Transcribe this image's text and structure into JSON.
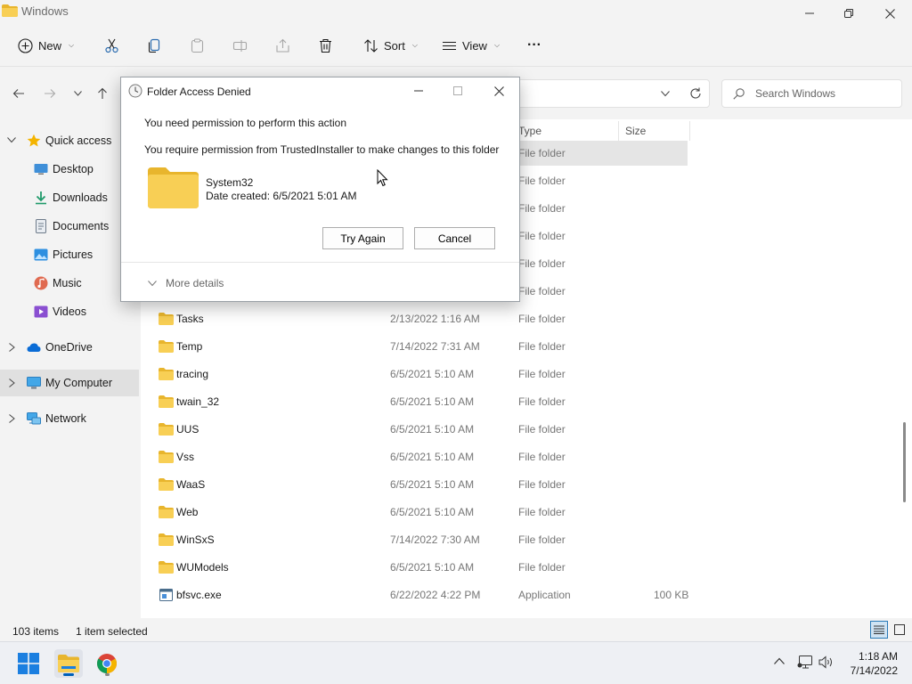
{
  "window": {
    "title": "Windows",
    "minimize_icon": "minimize-icon",
    "maximize_icon": "restore-icon",
    "close_icon": "close-icon"
  },
  "toolbar": {
    "new_label": "New",
    "sort_label": "Sort",
    "view_label": "View",
    "more_label": "···"
  },
  "search": {
    "placeholder": "Search Windows"
  },
  "sidebar": {
    "items": [
      {
        "label": "Quick access",
        "icon": "star-icon"
      },
      {
        "label": "Desktop",
        "icon": "desktop-icon"
      },
      {
        "label": "Downloads",
        "icon": "download-icon"
      },
      {
        "label": "Documents",
        "icon": "documents-icon"
      },
      {
        "label": "Pictures",
        "icon": "pictures-icon"
      },
      {
        "label": "Music",
        "icon": "music-icon"
      },
      {
        "label": "Videos",
        "icon": "videos-icon"
      },
      {
        "label": "OneDrive",
        "icon": "cloud-icon"
      },
      {
        "label": "My Computer",
        "icon": "computer-icon"
      },
      {
        "label": "Network",
        "icon": "network-icon"
      }
    ]
  },
  "columns": {
    "type": "Type",
    "size": "Size"
  },
  "files": [
    {
      "name": "",
      "date": "",
      "type": "File folder",
      "size": ""
    },
    {
      "name": "",
      "date": "",
      "type": "File folder",
      "size": ""
    },
    {
      "name": "",
      "date": "",
      "type": "File folder",
      "size": ""
    },
    {
      "name": "",
      "date": "",
      "type": "File folder",
      "size": ""
    },
    {
      "name": "",
      "date": "",
      "type": "File folder",
      "size": ""
    },
    {
      "name": "",
      "date": "",
      "type": "File folder",
      "size": ""
    },
    {
      "name": "Tasks",
      "date": "2/13/2022 1:16 AM",
      "type": "File folder",
      "size": ""
    },
    {
      "name": "Temp",
      "date": "7/14/2022 7:31 AM",
      "type": "File folder",
      "size": ""
    },
    {
      "name": "tracing",
      "date": "6/5/2021 5:10 AM",
      "type": "File folder",
      "size": ""
    },
    {
      "name": "twain_32",
      "date": "6/5/2021 5:10 AM",
      "type": "File folder",
      "size": ""
    },
    {
      "name": "UUS",
      "date": "6/5/2021 5:10 AM",
      "type": "File folder",
      "size": ""
    },
    {
      "name": "Vss",
      "date": "6/5/2021 5:10 AM",
      "type": "File folder",
      "size": ""
    },
    {
      "name": "WaaS",
      "date": "6/5/2021 5:10 AM",
      "type": "File folder",
      "size": ""
    },
    {
      "name": "Web",
      "date": "6/5/2021 5:10 AM",
      "type": "File folder",
      "size": ""
    },
    {
      "name": "WinSxS",
      "date": "7/14/2022 7:30 AM",
      "type": "File folder",
      "size": ""
    },
    {
      "name": "WUModels",
      "date": "6/5/2021 5:10 AM",
      "type": "File folder",
      "size": ""
    },
    {
      "name": "bfsvc.exe",
      "date": "6/22/2022 4:22 PM",
      "type": "Application",
      "size": "100 KB"
    }
  ],
  "status": {
    "item_count": "103 items",
    "selection": "1 item selected"
  },
  "taskbar": {
    "time": "1:18 AM",
    "date": "7/14/2022"
  },
  "dialog": {
    "title": "Folder Access Denied",
    "message1": "You need permission to perform this action",
    "message2": "You require permission from TrustedInstaller to make changes to this folder",
    "folder_name": "System32",
    "date_created": "Date created: 6/5/2021 5:01 AM",
    "try_again_label": "Try Again",
    "cancel_label": "Cancel",
    "more_details_label": "More details"
  },
  "colors": {
    "accent": "#005fb8",
    "folder": "#f8cf55",
    "folder_dark": "#e8b52d"
  }
}
